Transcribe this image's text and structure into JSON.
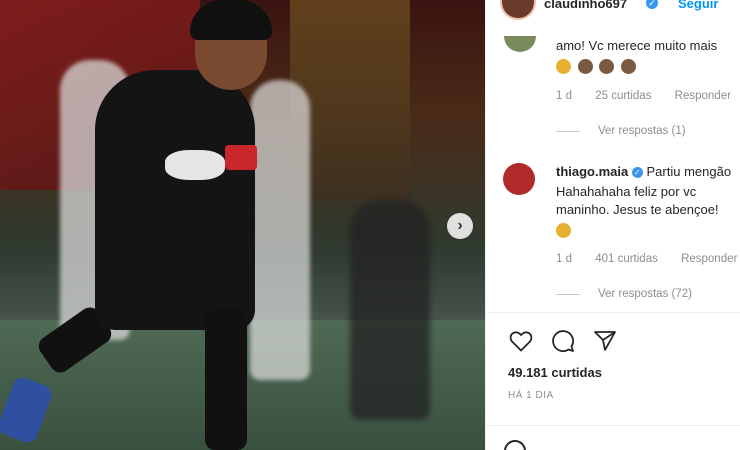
{
  "post": {
    "username": "claudinho697",
    "follow_label": "Seguir",
    "next_glyph": "›"
  },
  "comments": [
    {
      "text": "amo! Vc merece muito mais",
      "meta_time": "1 d",
      "meta_likes": "25 curtidas",
      "meta_reply": "Responder",
      "replies_label": "Ver respostas (1)"
    },
    {
      "username": "thiago.maia",
      "text_line1": "Partiu mengão",
      "text_line2": "Hahahahaha feliz por vc",
      "text_line3": "maninho. Jesus te abençoe!",
      "meta_time": "1 d",
      "meta_likes": "401 curtidas",
      "meta_reply": "Responder",
      "replies_label": "Ver respostas (72)"
    }
  ],
  "stats": {
    "likes": "49.181 curtidas",
    "time": "HÁ 1 DIA"
  },
  "icons": {
    "like": "heart-icon",
    "comment": "comment-icon",
    "share": "share-icon"
  },
  "colors": {
    "accent": "#0095f6",
    "verified": "#3897f0",
    "muted": "#8e8e8e"
  }
}
